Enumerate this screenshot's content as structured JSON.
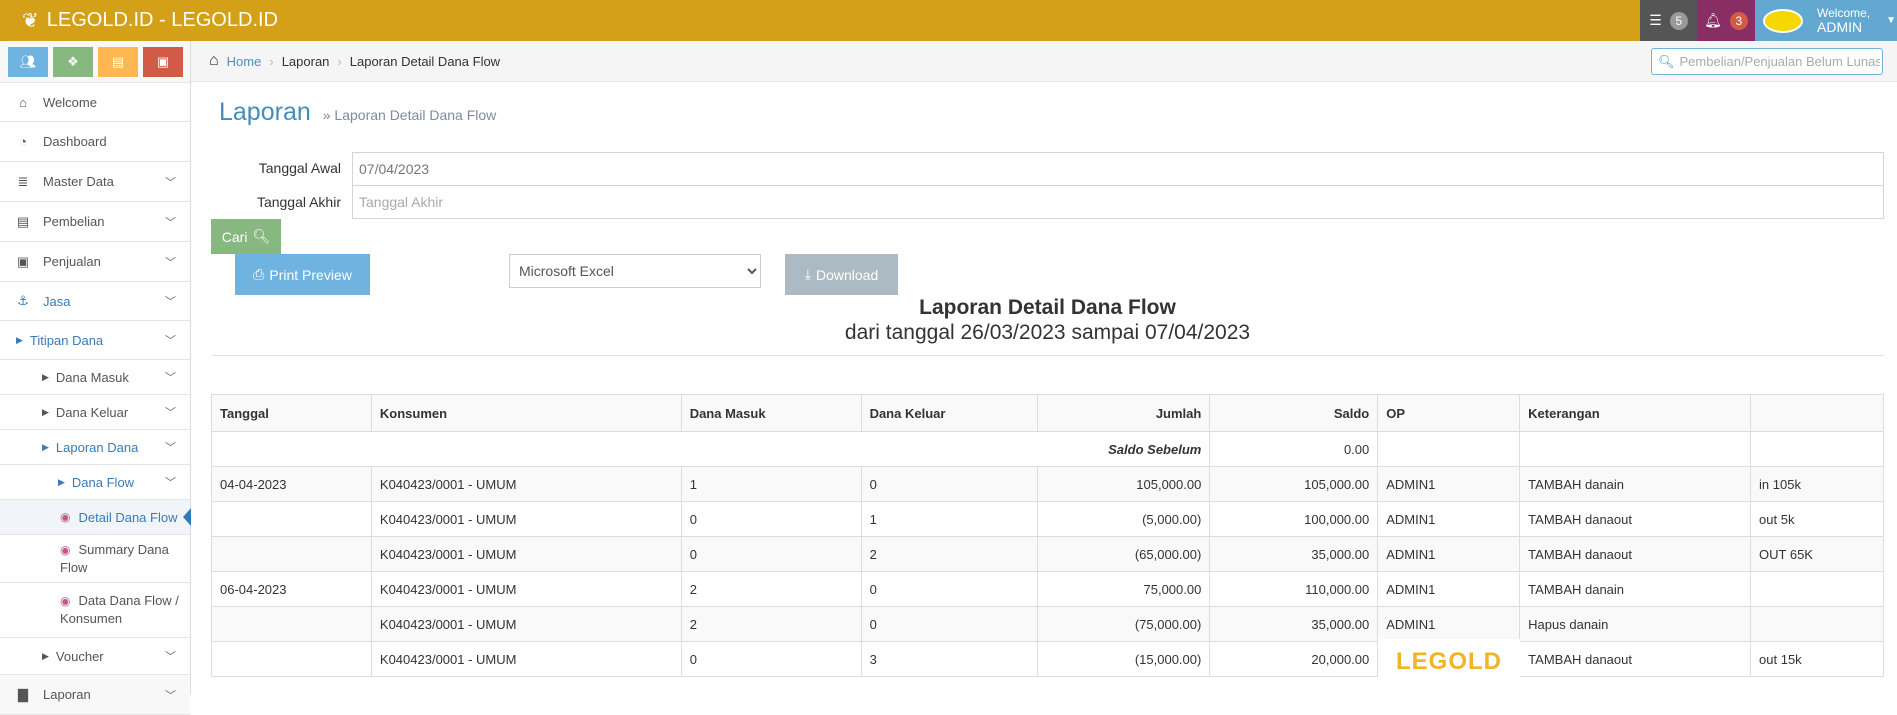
{
  "app": {
    "title": "LEGOLD.ID - LEGOLD.ID",
    "accent": "#d4a017"
  },
  "topbar": {
    "tasks_count": "5",
    "notifications_count": "3",
    "welcome": "Welcome,",
    "user": "ADMIN"
  },
  "sidebar": {
    "quick_buttons": [
      "users-icon",
      "cubes-icon",
      "basket-icon",
      "money-icon"
    ],
    "items": [
      {
        "label": "Welcome",
        "icon": "home-icon"
      },
      {
        "label": "Dashboard",
        "icon": "dashboard-icon"
      },
      {
        "label": "Master Data",
        "icon": "database-icon"
      },
      {
        "label": "Pembelian",
        "icon": "basket-icon"
      },
      {
        "label": "Penjualan",
        "icon": "money-icon"
      },
      {
        "label": "Jasa",
        "icon": "anchor-icon"
      },
      {
        "label": "Titipan Dana"
      },
      {
        "label": "Dana Masuk"
      },
      {
        "label": "Dana Keluar"
      },
      {
        "label": "Laporan Dana"
      },
      {
        "label": "Dana Flow"
      },
      {
        "label": "Detail Dana Flow"
      },
      {
        "label": "Summary Dana Flow"
      },
      {
        "label": "Data Dana Flow / Konsumen"
      },
      {
        "label": "Voucher"
      },
      {
        "label": "Laporan",
        "icon": "file-icon"
      }
    ]
  },
  "breadcrumb": [
    "Home",
    "Laporan",
    "Laporan Detail Dana Flow"
  ],
  "search": {
    "placeholder": "Pembelian/Penjualan Belum Lunas"
  },
  "page": {
    "title": "Laporan",
    "subtitle": "» Laporan Detail Dana Flow"
  },
  "form": {
    "start_label": "Tanggal Awal",
    "start_value": "07/04/2023",
    "end_label": "Tanggal Akhir",
    "end_placeholder": "Tanggal Akhir",
    "search_button": "Cari",
    "print_button": "Print Preview",
    "format_selected": "Microsoft Excel",
    "download_button": "Download"
  },
  "report": {
    "title": "Laporan Detail Dana Flow",
    "subtitle": "dari tanggal 26/03/2023 sampai 07/04/2023"
  },
  "table": {
    "headers": [
      "Tanggal",
      "Konsumen",
      "Dana Masuk",
      "Dana Keluar",
      "Jumlah",
      "Saldo",
      "OP",
      "Keterangan",
      ""
    ],
    "opening": {
      "label": "Saldo Sebelum",
      "value": "0.00"
    },
    "rows": [
      [
        "04-04-2023",
        "K040423/0001 - UMUM",
        "1",
        "0",
        "105,000.00",
        "105,000.00",
        "ADMIN1",
        "TAMBAH danain",
        "in 105k"
      ],
      [
        "",
        "K040423/0001 - UMUM",
        "0",
        "1",
        "(5,000.00)",
        "100,000.00",
        "ADMIN1",
        "TAMBAH danaout",
        "out 5k"
      ],
      [
        "",
        "K040423/0001 - UMUM",
        "0",
        "2",
        "(65,000.00)",
        "35,000.00",
        "ADMIN1",
        "TAMBAH danaout",
        "OUT 65K"
      ],
      [
        "06-04-2023",
        "K040423/0001 - UMUM",
        "2",
        "0",
        "75,000.00",
        "110,000.00",
        "ADMIN1",
        "TAMBAH danain",
        ""
      ],
      [
        "",
        "K040423/0001 - UMUM",
        "2",
        "0",
        "(75,000.00)",
        "35,000.00",
        "ADMIN1",
        "Hapus danain",
        ""
      ],
      [
        "",
        "K040423/0001 - UMUM",
        "0",
        "3",
        "(15,000.00)",
        "20,000.00",
        "",
        "TAMBAH danaout",
        "out 15k"
      ]
    ]
  },
  "watermark": "LEGOLD"
}
